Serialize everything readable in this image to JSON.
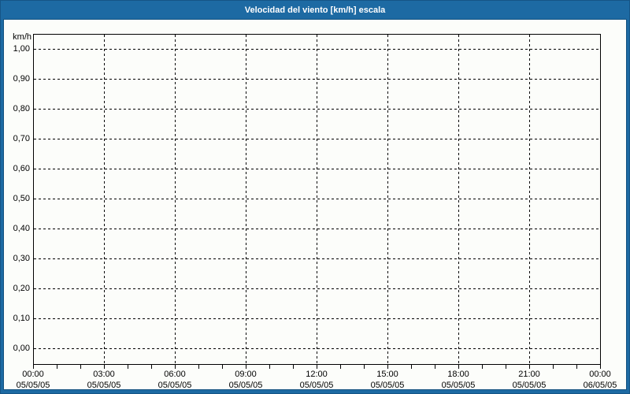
{
  "window": {
    "title": "Velocidad del viento [km/h] escala"
  },
  "colors": {
    "titlebar_bg": "#1d6aa3",
    "titlebar_text": "#ffffff",
    "frame_border": "#155586",
    "content_bg": "#fcfdfa",
    "content_border": "#13517f",
    "axis": "#000000",
    "grid": "#000000"
  },
  "chart_data": {
    "type": "line",
    "title": "Velocidad del viento [km/h] escala",
    "ylabel": "km/h",
    "xlabel": "",
    "ylim": [
      0.0,
      1.0
    ],
    "ytick_step": 0.1,
    "ytick_labels": [
      "1,00",
      "0,90",
      "0,80",
      "0,70",
      "0,60",
      "0,50",
      "0,40",
      "0,30",
      "0,20",
      "0,10",
      "0,00"
    ],
    "xticks": [
      {
        "time": "00:00",
        "date": "05/05/05"
      },
      {
        "time": "03:00",
        "date": "05/05/05"
      },
      {
        "time": "06:00",
        "date": "05/05/05"
      },
      {
        "time": "09:00",
        "date": "05/05/05"
      },
      {
        "time": "12:00",
        "date": "05/05/05"
      },
      {
        "time": "15:00",
        "date": "05/05/05"
      },
      {
        "time": "18:00",
        "date": "05/05/05"
      },
      {
        "time": "21:00",
        "date": "05/05/05"
      },
      {
        "time": "00:00",
        "date": "06/05/05"
      }
    ],
    "x_minor_ticks_between_major": 2,
    "grid": "dashed",
    "legend": "none",
    "series": []
  }
}
